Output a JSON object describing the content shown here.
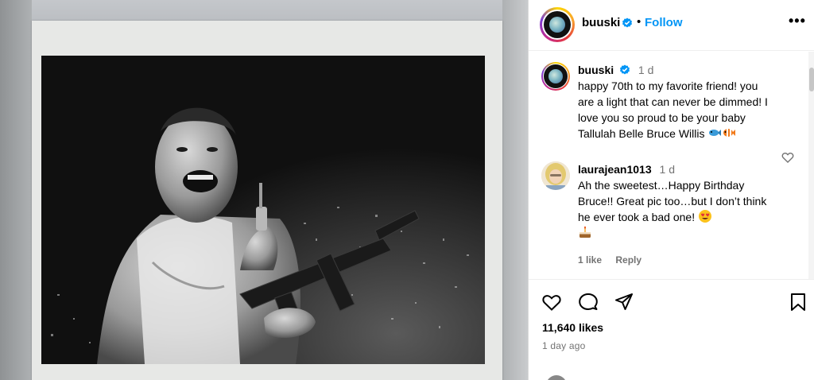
{
  "post": {
    "username": "buuski",
    "follow_label": "Follow",
    "more_label": "•••",
    "separator": "•"
  },
  "comments": [
    {
      "username": "buuski",
      "time": "1 d",
      "text": "happy 70th to my favorite friend! you are a light that can never be dimmed! I love you so proud to be your baby Tallulah Belle Bruce Willis",
      "emojis": [
        "fish",
        "clownfish"
      ]
    },
    {
      "username": "laurajean1013",
      "time": "1 d",
      "text": "Ah the sweetest…Happy Birthday Bruce!! Great pic too…but I don’t think he ever took a bad one!",
      "emojis": [
        "heart-eyes",
        "birthday-cake"
      ],
      "likes_label": "1 like",
      "reply_label": "Reply"
    }
  ],
  "stats": {
    "likes": "11,640 likes",
    "ago": "1 day ago"
  },
  "colors": {
    "accent": "#0095f6",
    "muted": "#737373",
    "border": "#dbdbdb"
  },
  "icons": [
    "verified-badge-icon",
    "more-options-icon",
    "like-heart-icon",
    "comment-icon",
    "share-icon",
    "bookmark-icon",
    "comment-like-icon"
  ]
}
